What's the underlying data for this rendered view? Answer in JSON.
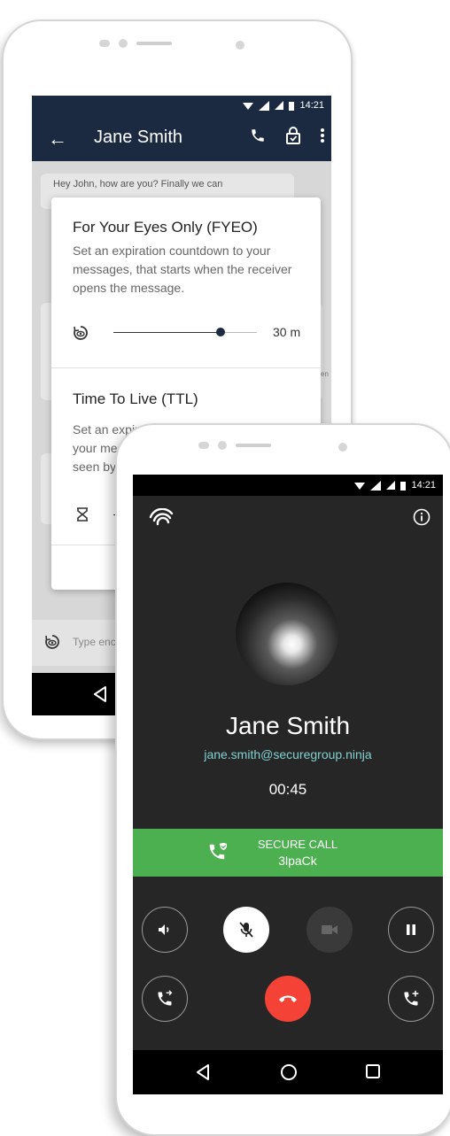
{
  "back_phone": {
    "status": {
      "time": "14:21"
    },
    "appbar": {
      "title": "Jane Smith"
    },
    "chat": {
      "message_preview": "Hey John, how are you? Finally we can",
      "side_snippet": "en"
    },
    "fyeo": {
      "title": "For Your Eyes Only (FYEO)",
      "description": "Set an expiration countdown to your messages, that starts when the receiver opens the message.",
      "value": "30 m",
      "slider_fraction": 0.7
    },
    "ttl": {
      "title": "Time To Live (TTL)",
      "description_line1": "Set an expiration time for each of",
      "description_line2": "your mess",
      "description_line3": "seen by"
    },
    "composer": {
      "placeholder": "Type enc"
    }
  },
  "front_phone": {
    "status": {
      "time": "14:21"
    },
    "contact": {
      "name": "Jane Smith",
      "email": "jane.smith@securegroup.ninja"
    },
    "call_timer": "00:45",
    "secure_call": {
      "label": "SECURE CALL",
      "code": "3lpaCk"
    },
    "colors": {
      "secure_green": "#4caf50",
      "end_call_red": "#f44336",
      "email_teal": "#7fd1d1",
      "appbar_navy": "#1b2a41"
    }
  }
}
